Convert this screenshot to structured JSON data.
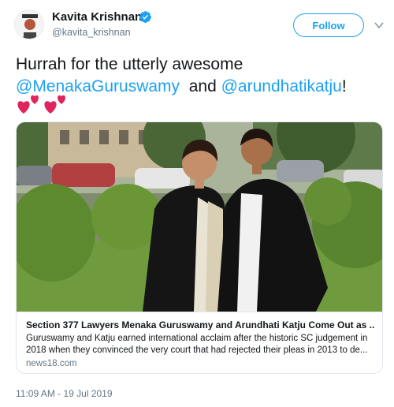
{
  "colors": {
    "accent": "#1da1f2",
    "text": "#14171a",
    "muted": "#657786",
    "border": "#e1e8ed",
    "heart": "#e0245e"
  },
  "author": {
    "name": "Kavita Krishnan",
    "handle": "@kavita_krishnan",
    "verified_icon": "verified-badge-icon"
  },
  "follow_label": "Follow",
  "tweet": {
    "text_prefix": "Hurrah for the utterly awesome ",
    "mention_1": "@MenakaGuruswamy",
    "text_middle": "  and ",
    "mention_2": "@arundhatikatju",
    "text_suffix": "!",
    "emoji": "two-hearts-icon"
  },
  "card": {
    "image_icon": "card-photo",
    "title": "Section 377 Lawyers Menaka Guruswamy and Arundhati Katju Come Out as ...",
    "description": "Guruswamy and Katju earned international acclaim after the historic SC judgement in 2018 when they convinced the very court that had rejected their pleas in 2013 to de...",
    "domain": "news18.com"
  },
  "timestamp": "11:09 AM - 19 Jul 2019"
}
